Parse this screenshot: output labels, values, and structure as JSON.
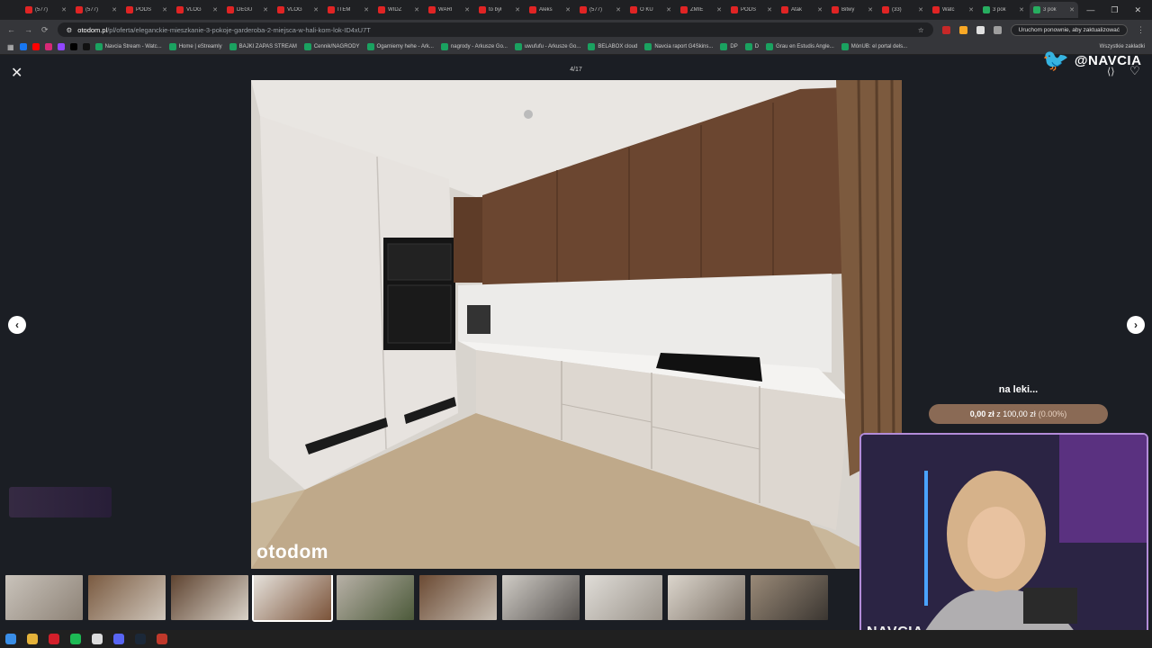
{
  "browser": {
    "tabs": [
      {
        "label": "(577)",
        "active": false
      },
      {
        "label": "(577)",
        "active": false
      },
      {
        "label": "PODS",
        "active": false
      },
      {
        "label": "VLOG",
        "active": false
      },
      {
        "label": "DEGU",
        "active": false
      },
      {
        "label": "VLOG",
        "active": false
      },
      {
        "label": "ITEM",
        "active": false
      },
      {
        "label": "WIDZ",
        "active": false
      },
      {
        "label": "WARI",
        "active": false
      },
      {
        "label": "to był",
        "active": false
      },
      {
        "label": "Aleks",
        "active": false
      },
      {
        "label": "(577)",
        "active": false
      },
      {
        "label": "O KU",
        "active": false
      },
      {
        "label": "ZMIE",
        "active": false
      },
      {
        "label": "PODS",
        "active": false
      },
      {
        "label": "Atak",
        "active": false
      },
      {
        "label": "Bitwy",
        "active": false
      },
      {
        "label": "(33)",
        "active": false
      },
      {
        "label": "Watc",
        "active": false
      },
      {
        "label": "3 pok",
        "active": false
      },
      {
        "label": "3 pok",
        "active": true
      }
    ],
    "url_host": "otodom.pl",
    "url_path": "/pl/oferta/eleganckie-mieszkanie-3-pokoje-garderoba-2-miejsca-w-hali-kom-lok-ID4xU7T",
    "update_label": "Uruchom ponownie, aby zaktualizować",
    "bookmarks": [
      "Navcia Stream - Watc...",
      "Home | eStreamly",
      "BAJKI ZAPAS STREAM",
      "Cennik/NAGRODY",
      "Ogarniemy hehe - Ark...",
      "nagrody - Arkusze Go...",
      "uwufufu - Arkusze Go...",
      "BELABOX cloud",
      "Navcia raport G4Skins...",
      "DP",
      "D",
      "Grau en Estudis Angle...",
      "MónUB: el portal dels..."
    ],
    "all_bookmarks": "Wszystkie zakładki"
  },
  "viewer": {
    "counter": "4/17",
    "watermark": "otodom",
    "icons": {
      "close": "close-icon",
      "share": "share-icon",
      "favorite": "heart-icon",
      "prev": "chevron-left-icon",
      "next": "chevron-right-icon"
    }
  },
  "overlay": {
    "twitter_handle": "@NAVCIA",
    "donation_title": "na leki...",
    "donation_amount": "0,00 zł",
    "donation_of": "z 100,00 zł",
    "donation_pct": "(0.00%)",
    "donation_progress": 0.0,
    "webcam_brand": "NAVCIA"
  },
  "colors": {
    "accent_purple": "#b38cd9",
    "donation_bar": "#8a6a55",
    "twitter_blue": "#1da1f2"
  }
}
